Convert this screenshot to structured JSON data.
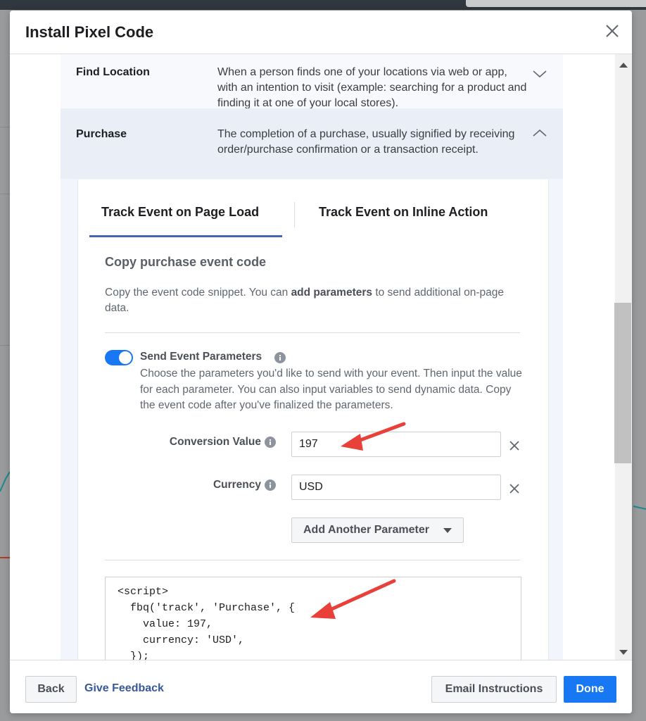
{
  "modal": {
    "title": "Install Pixel Code"
  },
  "events": [
    {
      "name": "Find Location",
      "description": "When a person finds one of your locations via web or app, with an intention to visit (example: searching for a product and finding it at one of your local stores).",
      "expanded": false
    },
    {
      "name": "Purchase",
      "description": "The completion of a purchase, usually signified by receiving order/purchase confirmation or a transaction receipt.",
      "expanded": true
    }
  ],
  "tabs": [
    {
      "label": "Track Event on Page Load",
      "active": true
    },
    {
      "label": "Track Event on Inline Action",
      "active": false
    }
  ],
  "section": {
    "title": "Copy purchase event code",
    "desc_before": "Copy the event code snippet. You can ",
    "desc_bold": "add parameters",
    "desc_after": " to send additional on-page data."
  },
  "parameters": {
    "toggle_on": true,
    "title": "Send Event Parameters",
    "description": "Choose the parameters you'd like to send with your event. Then input the value for each parameter. You can also input variables to send dynamic data. Copy the event code after you've finalized the parameters.",
    "fields": [
      {
        "label": "Conversion Value",
        "value": "197"
      },
      {
        "label": "Currency",
        "value": "USD"
      }
    ],
    "add_button": "Add Another Parameter"
  },
  "code_lines": [
    "<script>",
    "  fbq('track', 'Purchase', {",
    "    value: 197,",
    "    currency: 'USD',",
    "  });"
  ],
  "footer": {
    "back": "Back",
    "feedback": "Give Feedback",
    "email": "Email Instructions",
    "done": "Done"
  },
  "colors": {
    "primary_blue": "#1877f2",
    "tab_underline": "#4267b2",
    "annotation_red": "#e8413a"
  }
}
